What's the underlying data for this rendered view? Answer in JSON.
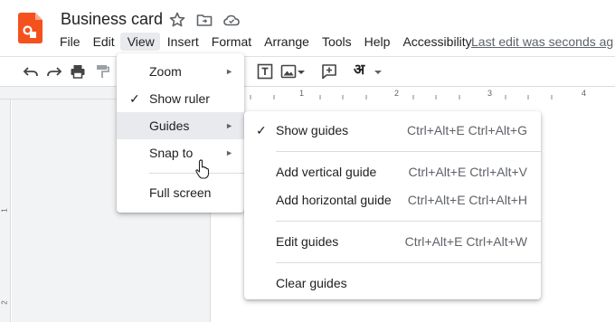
{
  "app": {
    "doc_title": "Business card",
    "icons": [
      "star-icon",
      "move-to-folder-icon",
      "cloud-status-icon"
    ],
    "brand_color": "#f4511e"
  },
  "menubar": {
    "items": [
      "File",
      "Edit",
      "View",
      "Insert",
      "Format",
      "Arrange",
      "Tools",
      "Help",
      "Accessibility"
    ],
    "active": "View",
    "last_edit": "Last edit was seconds ag"
  },
  "toolbar": {
    "input_tool_glyph": "अ"
  },
  "ruler": {
    "top_numbers": [
      "1",
      "2",
      "3",
      "4"
    ],
    "left_numbers": [
      "1",
      "2"
    ]
  },
  "view_menu": {
    "items": [
      {
        "label": "Zoom",
        "checked": false,
        "submenu": true
      },
      {
        "label": "Show ruler",
        "checked": true,
        "submenu": false
      },
      {
        "label": "Guides",
        "checked": false,
        "submenu": true,
        "highlighted": true
      },
      {
        "label": "Snap to",
        "checked": false,
        "submenu": true
      },
      {
        "label": "Full screen",
        "checked": false,
        "submenu": false
      }
    ],
    "check_glyph": "✓",
    "arrow_glyph": "►"
  },
  "guides_menu": {
    "items": [
      {
        "label": "Show guides",
        "checked": true,
        "shortcut": "Ctrl+Alt+E Ctrl+Alt+G"
      },
      {
        "label": "Add vertical guide",
        "checked": false,
        "shortcut": "Ctrl+Alt+E Ctrl+Alt+V"
      },
      {
        "label": "Add horizontal guide",
        "checked": false,
        "shortcut": "Ctrl+Alt+E Ctrl+Alt+H"
      },
      {
        "label": "Edit guides",
        "checked": false,
        "shortcut": "Ctrl+Alt+E Ctrl+Alt+W"
      },
      {
        "label": "Clear guides",
        "checked": false,
        "shortcut": ""
      }
    ]
  }
}
